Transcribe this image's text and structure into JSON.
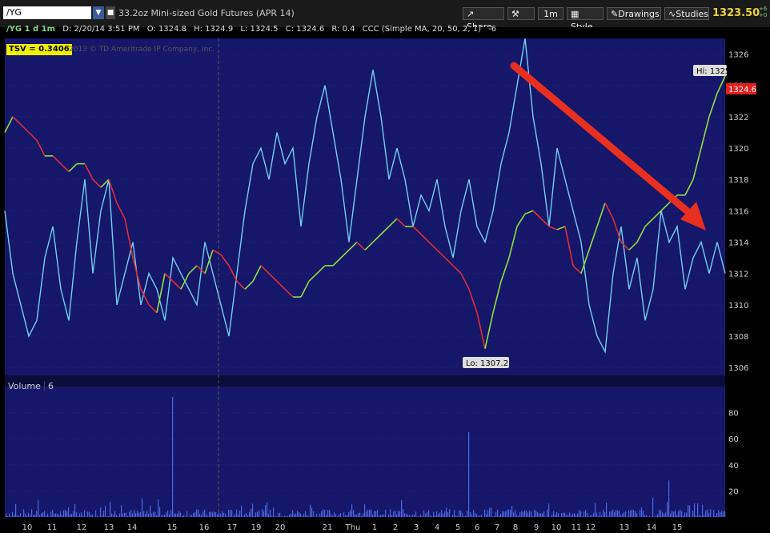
{
  "toolbar": {
    "symbol": "/YG",
    "description": "33.2oz Mini-sized Gold Futures (APR 14)",
    "share_label": "Share",
    "interval_label": "1m",
    "style_label": "Style",
    "drawings_label": "Drawings",
    "studies_label": "Studies",
    "last_price": "1323.50",
    "change_top": "+6",
    "change_bottom": "+0"
  },
  "infobar": {
    "sym": "/YG 1 d 1m",
    "date": "D: 2/20/14 3:51 PM",
    "open": "O: 1324.8",
    "high": "H: 1324.9",
    "low": "L: 1324.5",
    "close": "C: 1324.6",
    "range": "R: 0.4",
    "study": "CCC (Simple MA, 20, 50, 2, 1)",
    "study_val": "-6"
  },
  "tsv": "TSV  = 0.3406",
  "copyright": "2013 © TD Ameritrade IP Company, Inc.",
  "volume_label": "Volume",
  "volume_value": "6",
  "chart_data": {
    "type": "line",
    "price_axis": {
      "ticks": [
        1306,
        1308,
        1310,
        1312,
        1314,
        1316,
        1318,
        1320,
        1322,
        1324,
        1326
      ],
      "ylim": [
        1305.6,
        1327
      ]
    },
    "volume_axis": {
      "ticks": [
        20,
        40,
        60,
        80
      ],
      "ylim": [
        0,
        100
      ]
    },
    "x_ticks": [
      "10",
      "11",
      "12",
      "13",
      "14",
      "15",
      "16",
      "17",
      "19",
      "20",
      "21",
      "Thu",
      "1",
      "2",
      "3",
      "4",
      "5",
      "6",
      "7",
      "8",
      "9",
      "10",
      "11",
      "12",
      "13",
      "14",
      "15"
    ],
    "hi_label": "Hi: 1325",
    "lo_label": "Lo: 1307.2",
    "last_label": "1324.6",
    "price": [
      1321,
      1322,
      1321.5,
      1321,
      1320.5,
      1319.5,
      1319.5,
      1319,
      1318.5,
      1319,
      1319,
      1318,
      1317.5,
      1318,
      1316.5,
      1315.5,
      1313,
      1311,
      1310,
      1309.5,
      1312,
      1311.5,
      1311,
      1312,
      1312.5,
      1312,
      1313.5,
      1313.2,
      1312.5,
      1311.5,
      1311,
      1311.5,
      1312.5,
      1312,
      1311.5,
      1311,
      1310.5,
      1310.5,
      1311.5,
      1312,
      1312.5,
      1312.5,
      1313,
      1313.5,
      1314,
      1313.5,
      1314,
      1314.5,
      1315,
      1315.5,
      1315,
      1315,
      1314.5,
      1314,
      1313.5,
      1313,
      1312.5,
      1312,
      1311,
      1309.5,
      1307.2,
      1309.5,
      1311.5,
      1313,
      1315,
      1315.8,
      1316,
      1315.5,
      1315,
      1314.8,
      1315,
      1312.5,
      1312,
      1313.5,
      1315,
      1316.5,
      1315.5,
      1314,
      1313.5,
      1314,
      1315,
      1315.5,
      1316,
      1316.5,
      1317,
      1317,
      1318,
      1320,
      1322,
      1323.5,
      1324.6
    ],
    "tsv": [
      1316,
      1312,
      1310,
      1308,
      1309,
      1313,
      1315,
      1311,
      1309,
      1314,
      1318,
      1312,
      1316,
      1318,
      1310,
      1312,
      1314,
      1310,
      1312,
      1311,
      1309,
      1313,
      1312,
      1311,
      1310,
      1314,
      1312,
      1310,
      1308,
      1312,
      1316,
      1319,
      1320,
      1318,
      1321,
      1319,
      1320,
      1315,
      1319,
      1322,
      1324,
      1321,
      1318,
      1314,
      1318,
      1322,
      1325,
      1322,
      1318,
      1320,
      1318,
      1315,
      1317,
      1316,
      1318,
      1315,
      1313,
      1316,
      1318,
      1315,
      1314,
      1316,
      1319,
      1321,
      1324,
      1327,
      1322,
      1319,
      1315,
      1320,
      1318,
      1316,
      1314,
      1310,
      1308,
      1307,
      1312,
      1315,
      1311,
      1313,
      1309,
      1311,
      1316,
      1314,
      1315,
      1311,
      1313,
      1314,
      1312,
      1314,
      1312
    ]
  }
}
